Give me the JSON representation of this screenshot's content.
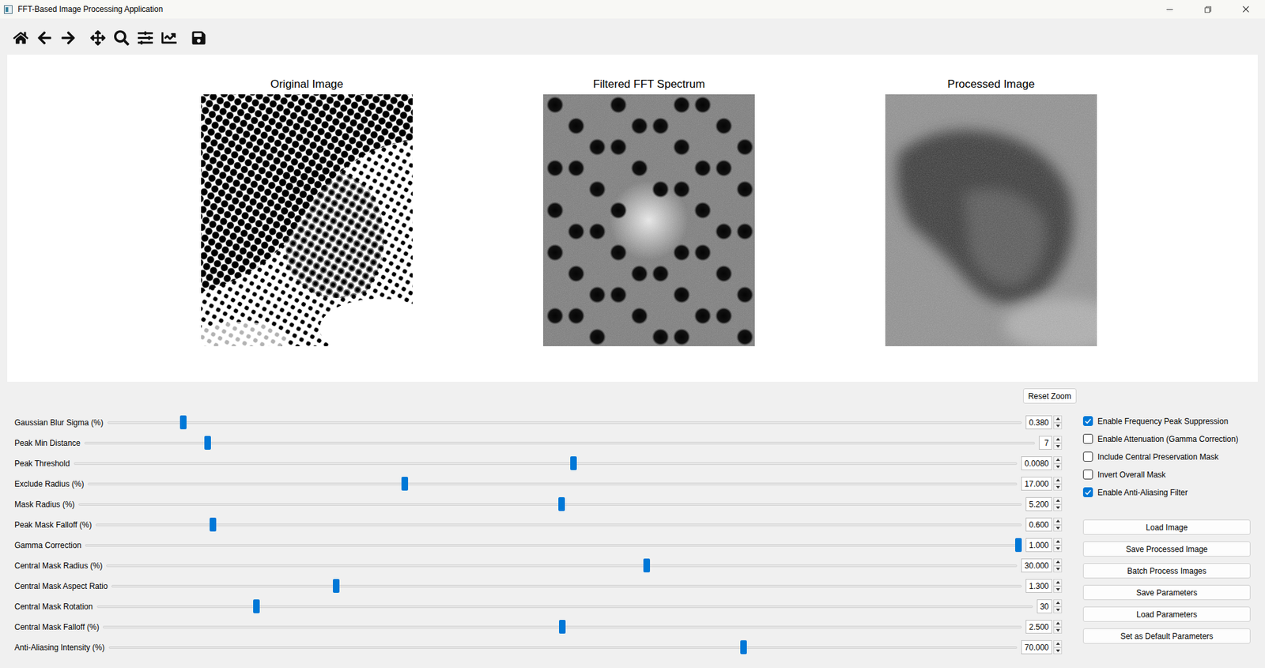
{
  "window": {
    "title": "FFT-Based Image Processing Application"
  },
  "figure": {
    "panels": [
      {
        "title": "Original Image",
        "kind": "halftone"
      },
      {
        "title": "Filtered FFT Spectrum",
        "kind": "spectrum"
      },
      {
        "title": "Processed Image",
        "kind": "processed"
      }
    ]
  },
  "reset_zoom": "Reset Zoom",
  "sliders": [
    {
      "label": "Gaussian Blur Sigma (%)",
      "value": "0.380",
      "level": 0.08
    },
    {
      "label": "Peak Min Distance",
      "value": "7",
      "level": 0.127
    },
    {
      "label": "Peak Threshold",
      "value": "0.0080",
      "level": 0.53
    },
    {
      "label": "Exclude Radius (%)",
      "value": "17.000",
      "level": 0.34
    },
    {
      "label": "Mask Radius (%)",
      "value": "5.200",
      "level": 0.512
    },
    {
      "label": "Peak Mask Falloff (%)",
      "value": "0.600",
      "level": 0.124
    },
    {
      "label": "Gamma Correction",
      "value": "1.000",
      "level": 1.0
    },
    {
      "label": "Central Mask Radius (%)",
      "value": "30.000",
      "level": 0.594
    },
    {
      "label": "Central Mask Aspect Ratio",
      "value": "1.300",
      "level": 0.245
    },
    {
      "label": "Central Mask Rotation",
      "value": "30",
      "level": 0.168
    },
    {
      "label": "Central Mask Falloff (%)",
      "value": "2.500",
      "level": 0.5
    },
    {
      "label": "Anti-Aliasing Intensity (%)",
      "value": "70.000",
      "level": 0.7
    }
  ],
  "checkboxes": [
    {
      "label": "Enable Frequency Peak Suppression",
      "checked": true
    },
    {
      "label": "Enable Attenuation (Gamma Correction)",
      "checked": false
    },
    {
      "label": "Include Central Preservation Mask",
      "checked": false
    },
    {
      "label": "Invert Overall Mask",
      "checked": false
    },
    {
      "label": "Enable Anti-Aliasing Filter",
      "checked": true
    }
  ],
  "buttons": [
    "Load Image",
    "Save Processed Image",
    "Batch Process Images",
    "Save Parameters",
    "Load Parameters",
    "Set as Default Parameters"
  ]
}
